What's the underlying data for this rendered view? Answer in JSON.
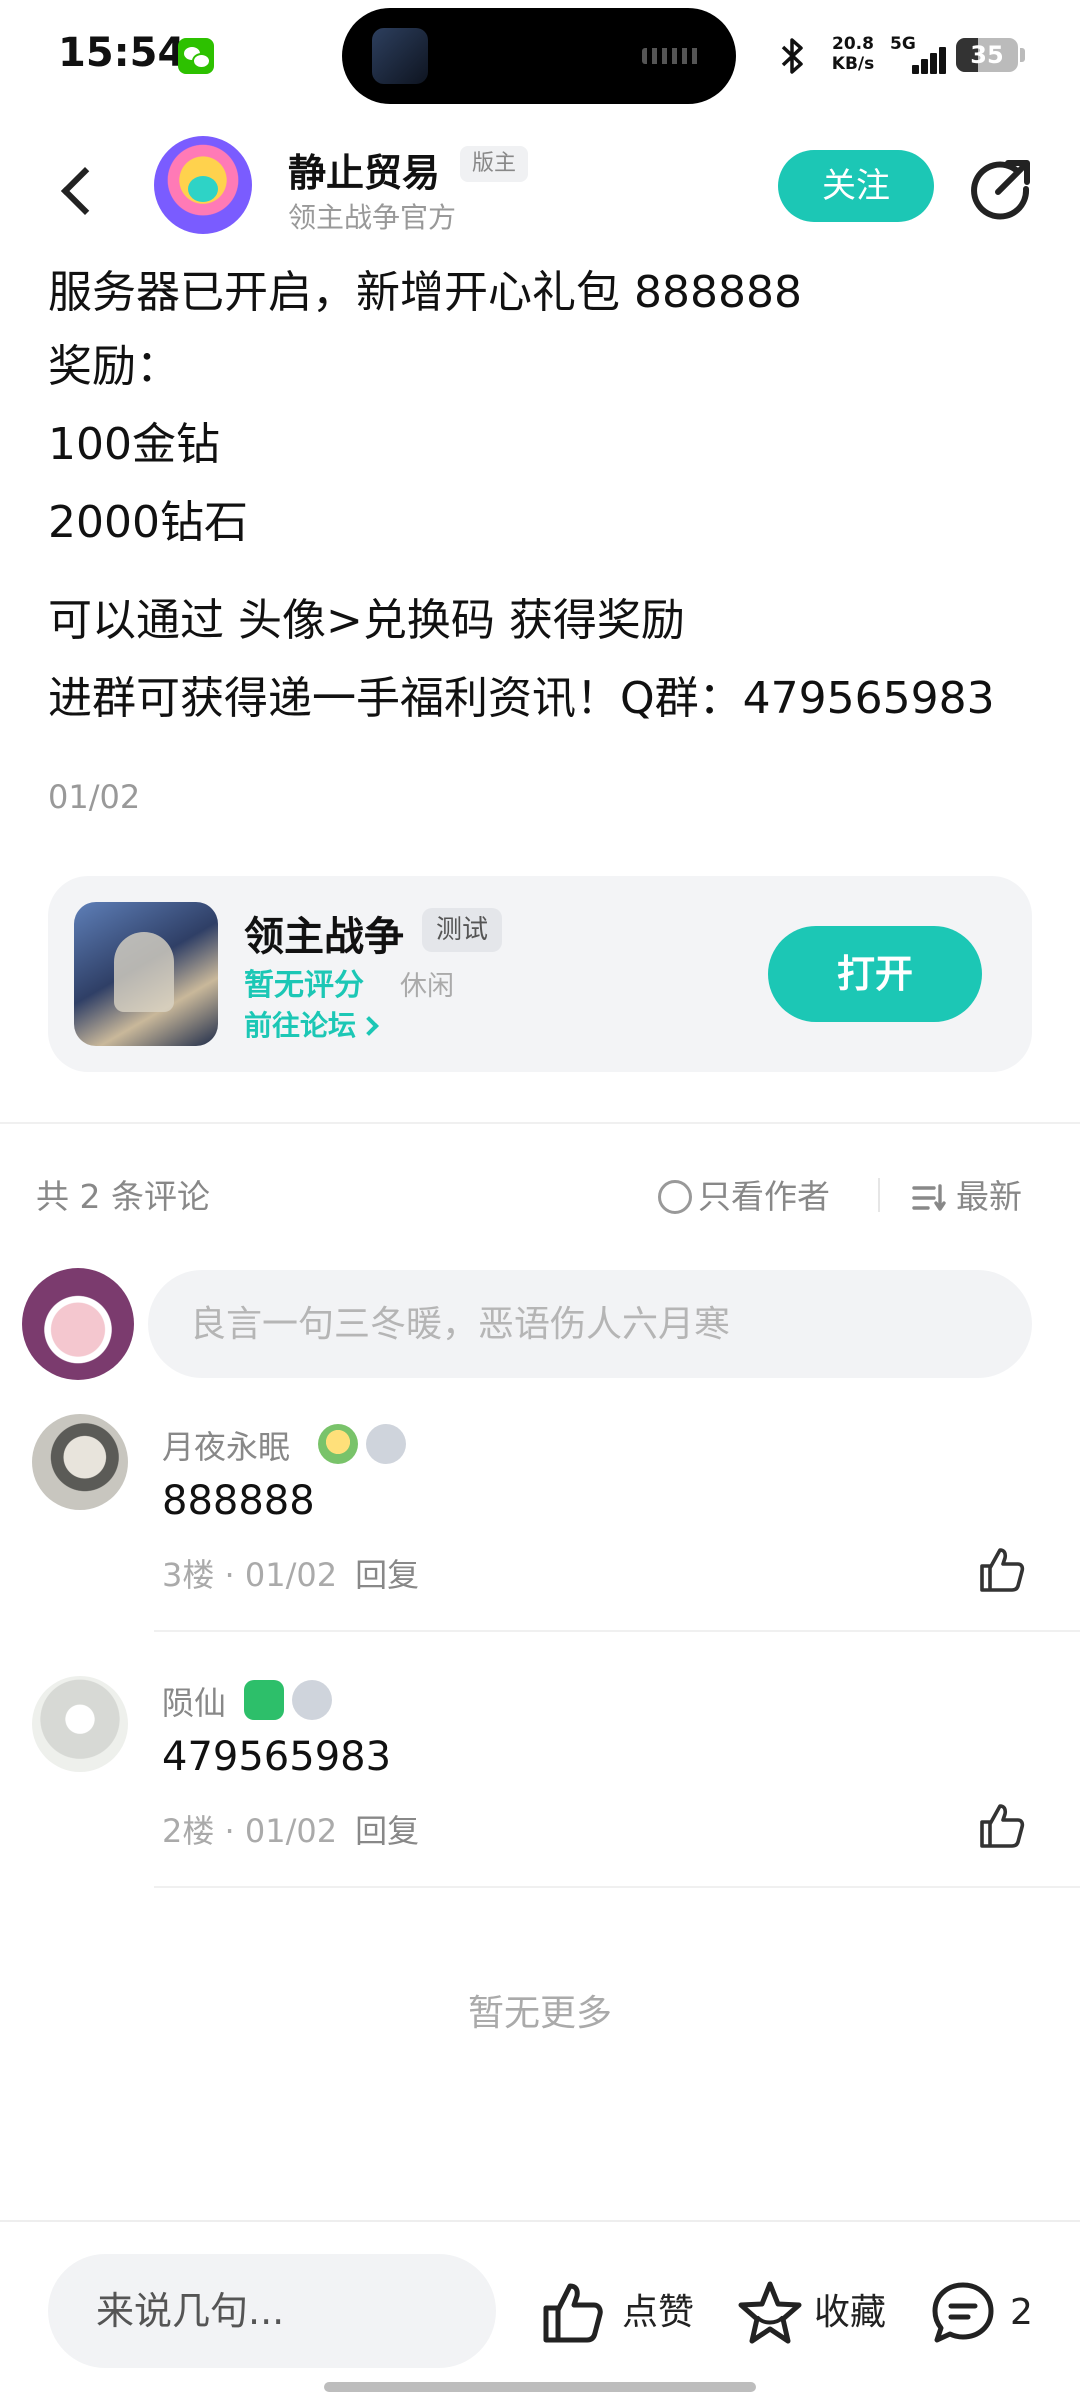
{
  "status_bar": {
    "time": "15:54",
    "net_speed_value": "20.8",
    "net_speed_unit": "KB/s",
    "network": "5G",
    "battery": "35",
    "battery_level": 0.35,
    "icons": [
      "wechat-icon",
      "bluetooth-icon",
      "signal-icon",
      "battery-icon"
    ]
  },
  "header": {
    "author_name": "静止贸易",
    "author_badge": "版主",
    "author_subtitle": "领主战争官方",
    "follow_label": "关注",
    "icons": [
      "back-icon",
      "share-icon"
    ]
  },
  "post": {
    "lines": [
      "服务器已开启，新增开心礼包 888888",
      "奖励：",
      "100金钻",
      "2000钻石",
      "可以通过 头像>兑换码 获得奖励",
      "进群可获得递一手福利资讯！Q群：479565983"
    ],
    "date": "01/02"
  },
  "game_card": {
    "name": "领主战争",
    "tag": "测试",
    "rating": "暂无评分",
    "genre": "休闲",
    "forum_link": "前往论坛",
    "open_label": "打开"
  },
  "comments_header": {
    "count": "共 2 条评论",
    "author_only": "只看作者",
    "sort": "最新"
  },
  "comment_input": {
    "placeholder": "良言一句三冬暖，恶语伤人六月寒"
  },
  "comments": [
    {
      "name": "月夜永眠",
      "badge_level": "T2",
      "text": "888888",
      "floor": "3楼",
      "date": "01/02",
      "reply": "回复"
    },
    {
      "name": "陨仙",
      "badge_level": "T1",
      "text": "479565983",
      "floor": "2楼",
      "date": "01/02",
      "reply": "回复"
    }
  ],
  "no_more": "暂无更多",
  "bottom_bar": {
    "input_placeholder": "来说几句...",
    "like_label": "点赞",
    "collect_label": "收藏",
    "comment_count": "2"
  },
  "colors": {
    "accent": "#1cc7b5",
    "text": "#111111",
    "muted": "#999999"
  }
}
